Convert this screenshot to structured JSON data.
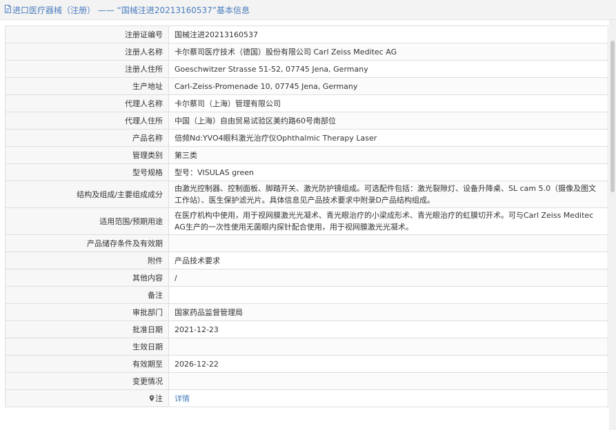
{
  "header": {
    "icon": "document-icon",
    "title": "进口医疗器械（注册） —— “国械注进20213160537”基本信息"
  },
  "colors": {
    "accent": "#4a7dbe",
    "label_bg": "#f7f7f7",
    "border": "#dedede"
  },
  "rows": [
    {
      "label": "注册证编号",
      "value": "国械注进20213160537"
    },
    {
      "label": "注册人名称",
      "value": "卡尔蔡司医疗技术（德国）股份有限公司 Carl Zeiss Meditec AG"
    },
    {
      "label": "注册人住所",
      "value": "Goeschwitzer Strasse 51-52, 07745 Jena, Germany"
    },
    {
      "label": "生产地址",
      "value": "Carl-Zeiss-Promenade 10, 07745 Jena, Germany"
    },
    {
      "label": "代理人名称",
      "value": "卡尔蔡司（上海）管理有限公司"
    },
    {
      "label": "代理人住所",
      "value": "中国（上海）自由贸易试验区美约路60号南部位"
    },
    {
      "label": "产品名称",
      "value": "倍频Nd:YVO4眼科激光治疗仪Ophthalmic Therapy Laser"
    },
    {
      "label": "管理类别",
      "value": "第三类"
    },
    {
      "label": "型号规格",
      "value": "型号：VISULAS green"
    },
    {
      "label": "结构及组成/主要组成成分",
      "value": "由激光控制器、控制面板、脚踏开关、激光防护镜组成。可选配件包括：激光裂隙灯、设备升降桌、SL cam 5.0（摄像及图文工作站）、医生保护滤光片。具体信息见产品技术要求中附录D产品结构组成。"
    },
    {
      "label": "适用范围/预期用途",
      "value": "在医疗机构中使用，用于视网膜激光光凝术、青光眼治疗的小梁成形术、青光眼治疗的虹膜切开术。可与Carl Zeiss Meditec AG生产的一次性使用无菌眼内探针配合使用，用于视网膜激光光凝术。"
    },
    {
      "label": "产品储存条件及有效期",
      "value": ""
    },
    {
      "label": "附件",
      "value": "产品技术要求"
    },
    {
      "label": "其他内容",
      "value": "/"
    },
    {
      "label": "备注",
      "value": ""
    },
    {
      "label": "审批部门",
      "value": "国家药品监督管理局"
    },
    {
      "label": "批准日期",
      "value": "2021-12-23"
    },
    {
      "label": "生效日期",
      "value": ""
    },
    {
      "label": "有效期至",
      "value": "2026-12-22"
    },
    {
      "label": "变更情况",
      "value": ""
    }
  ],
  "note_row": {
    "icon": "pin-icon",
    "label": "注",
    "link_label": "详情"
  }
}
